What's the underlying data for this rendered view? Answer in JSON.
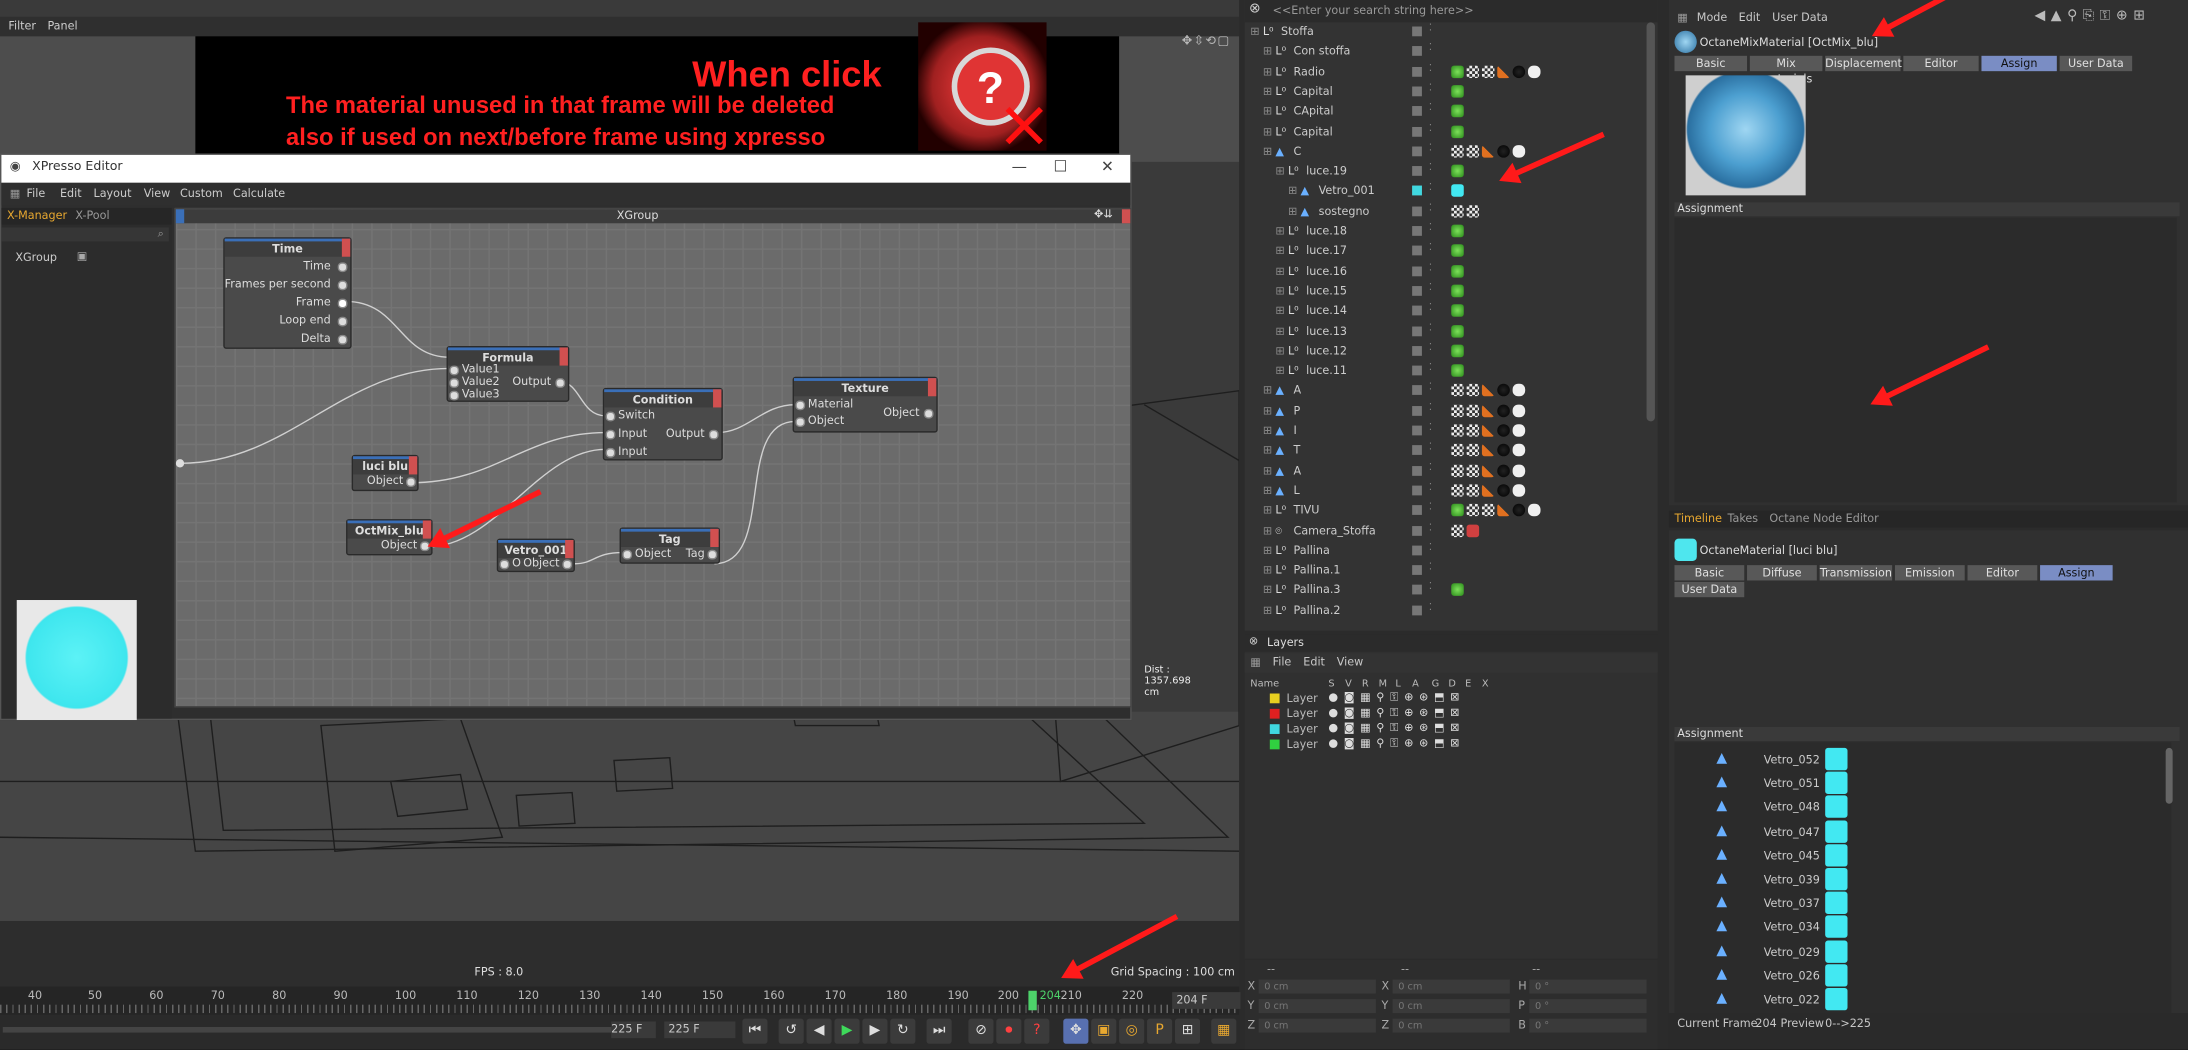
{
  "viewport": {
    "menu": [
      "Filter",
      "Panel"
    ],
    "fps": "FPS : 8.0",
    "grid_spacing": "Grid Spacing : 100 cm"
  },
  "banner": {
    "title": "When click",
    "line1": "The material unused in that frame will be deleted",
    "line2": "also if used on next/before frame using xpresso"
  },
  "xpresso": {
    "window_title": "XPresso Editor",
    "menu": [
      "File",
      "Edit",
      "Layout",
      "View",
      "Custom",
      "Calculate"
    ],
    "tabs": [
      "X-Manager",
      "X-Pool"
    ],
    "tree_item": "XGroup",
    "canvas_title": "XGroup",
    "dist": "Dist : 1357.698 cm",
    "nodes": {
      "time": {
        "title": "Time",
        "ports": [
          "Time",
          "Frames per second",
          "Frame",
          "Loop end",
          "Delta"
        ]
      },
      "formula": {
        "title": "Formula",
        "inputs": [
          "Value1",
          "Value2",
          "Value3"
        ],
        "output": "Output"
      },
      "condition": {
        "title": "Condition",
        "inputs": [
          "Switch",
          "Input",
          "Input"
        ],
        "output": "Output"
      },
      "texture": {
        "title": "Texture",
        "inputs": [
          "Material",
          "Object"
        ],
        "output": "Object"
      },
      "luci": {
        "title": "luci blu",
        "output": "Object"
      },
      "octmix": {
        "title": "OctMix_blu",
        "output": "Object"
      },
      "vetro": {
        "title": "Vetro_001",
        "input": "O",
        "output": "Object"
      },
      "tag": {
        "title": "Tag",
        "input": "Object",
        "output": "Tag"
      }
    }
  },
  "object_manager": {
    "search_placeholder": "<<Enter your search string here>>",
    "rows": [
      "Stoffa",
      "Con stoffa",
      "Radio",
      "Capital",
      "CApital",
      "Capital",
      "C",
      "luce.19",
      "Vetro_001",
      "sostegno",
      "luce.18",
      "luce.17",
      "luce.16",
      "luce.15",
      "luce.14",
      "luce.13",
      "luce.12",
      "luce.11",
      "A",
      "P",
      "I",
      "T",
      "A",
      "L",
      "TIVU",
      "Camera_Stoffa",
      "Pallina",
      "Pallina.1",
      "Pallina.3",
      "Pallina.2"
    ]
  },
  "layers": {
    "title": "Layers",
    "menu": [
      "File",
      "Edit",
      "View"
    ],
    "columns": [
      "Name",
      "S",
      "V",
      "R",
      "M",
      "L",
      "A",
      "G",
      "D",
      "E",
      "X"
    ],
    "rows": [
      {
        "name": "Layer",
        "color": "#e8d020"
      },
      {
        "name": "Layer",
        "color": "#e02020"
      },
      {
        "name": "Layer",
        "color": "#40d8e0"
      },
      {
        "name": "Layer",
        "color": "#30d040"
      }
    ]
  },
  "coords": {
    "dashes": [
      "--",
      "--",
      "--"
    ],
    "rows": [
      {
        "a": "X",
        "av": "0 cm",
        "b": "X",
        "bv": "0 cm",
        "c": "H",
        "cv": "0 °"
      },
      {
        "a": "Y",
        "av": "0 cm",
        "b": "Y",
        "bv": "0 cm",
        "c": "P",
        "cv": "0 °"
      },
      {
        "a": "Z",
        "av": "0 cm",
        "b": "Z",
        "bv": "0 cm",
        "c": "B",
        "cv": "0 °"
      }
    ]
  },
  "attributes": {
    "menu": [
      "Mode",
      "Edit",
      "User Data"
    ],
    "material_name": "OctaneMixMaterial [OctMix_blu]",
    "tabs": [
      "Basic",
      "Mix materials",
      "Displacement",
      "Editor",
      "Assign",
      "User Data"
    ],
    "active_tab": "Assign",
    "assignment_label": "Assignment"
  },
  "timeline_tabs": [
    "Timeline",
    "Takes",
    "Octane Node Editor"
  ],
  "attributes2": {
    "material_name": "OctaneMaterial [luci blu]",
    "tabs": [
      "Basic",
      "Diffuse",
      "Transmission",
      "Emission",
      "Editor",
      "Assign",
      "User Data"
    ],
    "assignment_label": "Assignment",
    "assigned": [
      "Vetro_052",
      "Vetro_051",
      "Vetro_048",
      "Vetro_047",
      "Vetro_045",
      "Vetro_039",
      "Vetro_037",
      "Vetro_034",
      "Vetro_029",
      "Vetro_026",
      "Vetro_022"
    ]
  },
  "timeline": {
    "ticks": [
      "40",
      "50",
      "60",
      "70",
      "80",
      "90",
      "100",
      "110",
      "120",
      "130",
      "140",
      "150",
      "160",
      "170",
      "180",
      "190",
      "200",
      "204",
      "210",
      "220"
    ],
    "current_frame_field": "204 F",
    "end_field_a": "225 F",
    "end_field_b": "225 F"
  },
  "status": {
    "current_frame_label": "Current Frame",
    "current_frame": "204",
    "preview_label": "Preview",
    "preview_range": "0-->225"
  }
}
